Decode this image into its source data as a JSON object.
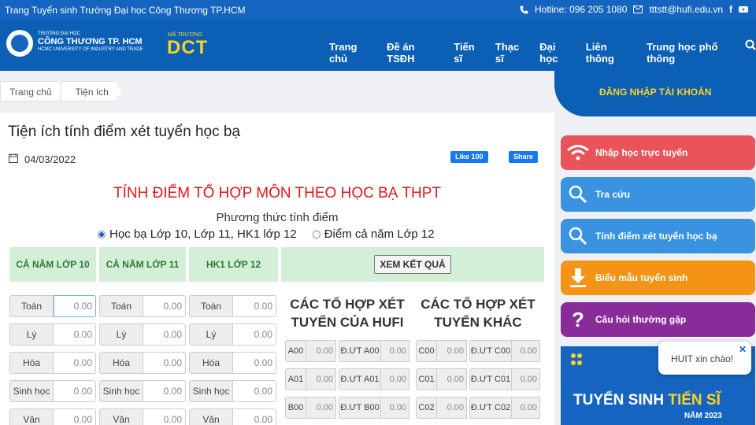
{
  "topbar": {
    "left": "Trang Tuyển sinh Trường Đại học Công Thương TP.HCM",
    "hotline": "Hotline: 096 205 1080",
    "email": "tttstt@hufi.edu.vn"
  },
  "logo": {
    "small": "TRƯỜNG ĐẠI HỌC",
    "big": "CÔNG THƯƠNG TP. HCM",
    "en": "HCMC UNIVERSITY OF INDUSTRY AND TRADE",
    "matruong": "MÃ TRƯỜNG",
    "code": "DCT"
  },
  "nav": [
    "Trang chủ",
    "Đề án TSĐH",
    "Tiến sĩ",
    "Thạc sĩ",
    "Đại học",
    "Liên thông",
    "Trung học phổ thông"
  ],
  "breadcrumb": [
    "Trang chủ",
    "Tiện ích"
  ],
  "login": "ĐĂNG NHẬP TÀI KHOẢN",
  "page": {
    "title": "Tiện ích tính điểm xét tuyển học bạ",
    "date": "04/03/2022",
    "fb_like": "Like 100",
    "fb_share": "Share"
  },
  "calc": {
    "title": "TÍNH ĐIỂM TỔ HỢP MÔN THEO HỌC BẠ THPT",
    "method_label": "Phương thức tính điểm",
    "radio1": "Học bạ Lớp 10, Lớp 11, HK1 lớp 12",
    "radio2": "Điểm cả năm Lớp 12",
    "col1": "CẢ NĂM LỚP 10",
    "col2": "CẢ NĂM LỚP 11",
    "col3": "HK1 LỚP 12",
    "button": "XEM KẾT QUẢ",
    "subjects": [
      "Toán",
      "Lý",
      "Hóa",
      "Sinh học",
      "Văn"
    ],
    "default_score": "0.00",
    "hufi_title_1": "CÁC TỔ HỢP XÉT",
    "hufi_title_2": "TUYỂN CỦA HUFI",
    "other_title_1": "CÁC TỔ HỢP XÉT",
    "other_title_2": "TUYỂN KHÁC",
    "hufi_rows": [
      [
        "A00",
        "Đ.ƯT A00"
      ],
      [
        "A01",
        "Đ.ƯT A01"
      ],
      [
        "B00",
        "Đ.ƯT B00"
      ]
    ],
    "other_rows": [
      [
        "C00",
        "Đ.ƯT C00"
      ],
      [
        "C01",
        "Đ.ƯT C01"
      ],
      [
        "C02",
        "Đ.ƯT C02"
      ]
    ]
  },
  "sidebar": [
    {
      "label": "Nhập học trực tuyến",
      "color": "#e8545a"
    },
    {
      "label": "Tra cứu",
      "color": "#3a93e0"
    },
    {
      "label": "Tính điểm xét tuyển học bạ",
      "color": "#3a93e0"
    },
    {
      "label": "Biểu mẫu tuyển sinh",
      "color": "#f59314"
    },
    {
      "label": "Câu hỏi thường gặp",
      "color": "#8a2b9a"
    }
  ],
  "banner": {
    "t1a": "TUYỂN SINH",
    "t1b": "TIẾN SĨ",
    "t2": "NĂM 2023"
  },
  "chat": "HUIT xin chào!"
}
